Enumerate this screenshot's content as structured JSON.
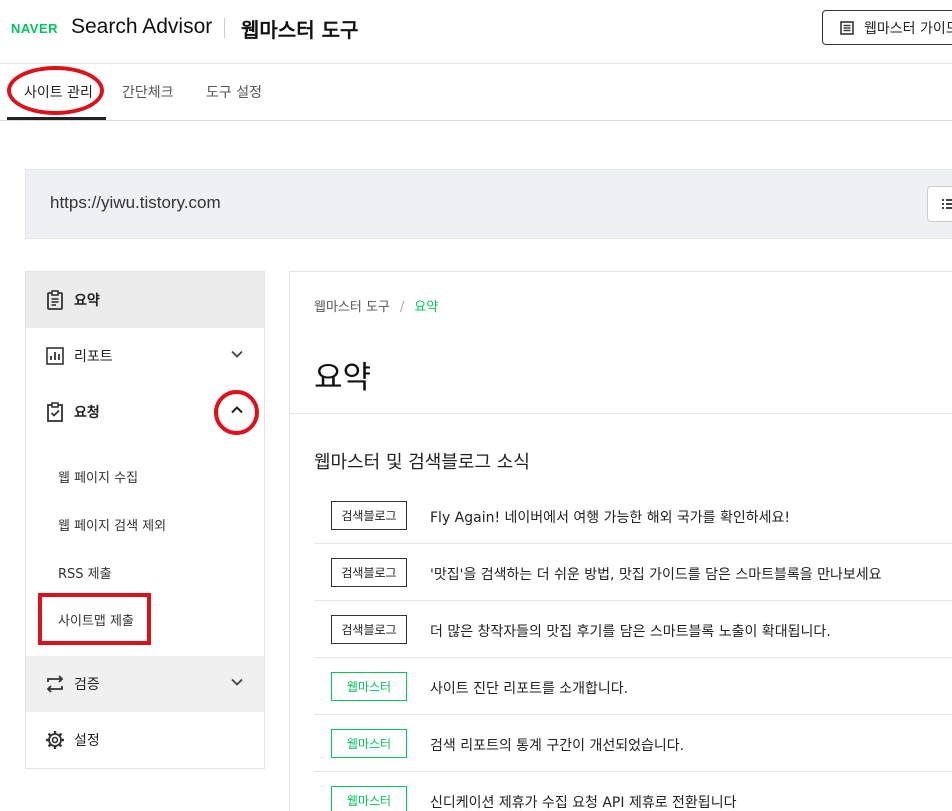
{
  "header": {
    "logo": "NAVER",
    "product": "Search Advisor",
    "tool": "웹마스터 도구",
    "guide_button": "웹마스터 가이드"
  },
  "tabs": [
    {
      "label": "사이트 관리",
      "active": true
    },
    {
      "label": "간단체크",
      "active": false
    },
    {
      "label": "도구 설정",
      "active": false
    }
  ],
  "site": {
    "url": "https://yiwu.tistory.com"
  },
  "sidebar": {
    "items": [
      {
        "label": "요약",
        "icon": "clipboard-icon",
        "selected": true
      },
      {
        "label": "리포트",
        "icon": "bar-chart-icon",
        "expanded": false
      },
      {
        "label": "요청",
        "icon": "clipboard-check-icon",
        "expanded": true
      },
      {
        "label": "검증",
        "icon": "sync-icon",
        "expanded": false
      },
      {
        "label": "설정",
        "icon": "gear-icon"
      }
    ],
    "sub_items": [
      {
        "label": "웹 페이지 수집"
      },
      {
        "label": "웹 페이지 검색 제외"
      },
      {
        "label": "RSS 제출"
      },
      {
        "label": "사이트맵 제출"
      }
    ]
  },
  "main": {
    "breadcrumb": {
      "root": "웹마스터 도구",
      "sep": "/",
      "current": "요약"
    },
    "title": "요약",
    "news_title": "웹마스터 및 검색블로그 소식",
    "news": [
      {
        "badge": "검색블로그",
        "badge_color": "#333333",
        "title": "Fly Again! 네이버에서 여행 가능한 해외 국가를 확인하세요!"
      },
      {
        "badge": "검색블로그",
        "badge_color": "#333333",
        "title": "'맛집'을 검색하는 더 쉬운 방법, 맛집 가이드를 담은 스마트블록을 만나보세요"
      },
      {
        "badge": "검색블로그",
        "badge_color": "#333333",
        "title": "더 많은 창작자들의 맛집 후기를 담은 스마트블록 노출이 확대됩니다."
      },
      {
        "badge": "웹마스터",
        "badge_color": "#03c75a",
        "title": "사이트 진단 리포트를 소개합니다."
      },
      {
        "badge": "웹마스터",
        "badge_color": "#03c75a",
        "title": "검색 리포트의 통계 구간이 개선되었습니다."
      },
      {
        "badge": "웹마스터",
        "badge_color": "#03c75a",
        "title": "신디케이션 제휴가 수집 요청 API 제휴로 전환됩니다"
      }
    ]
  },
  "colors": {
    "brand": "#03c75a",
    "annotation": "#e0101a"
  }
}
